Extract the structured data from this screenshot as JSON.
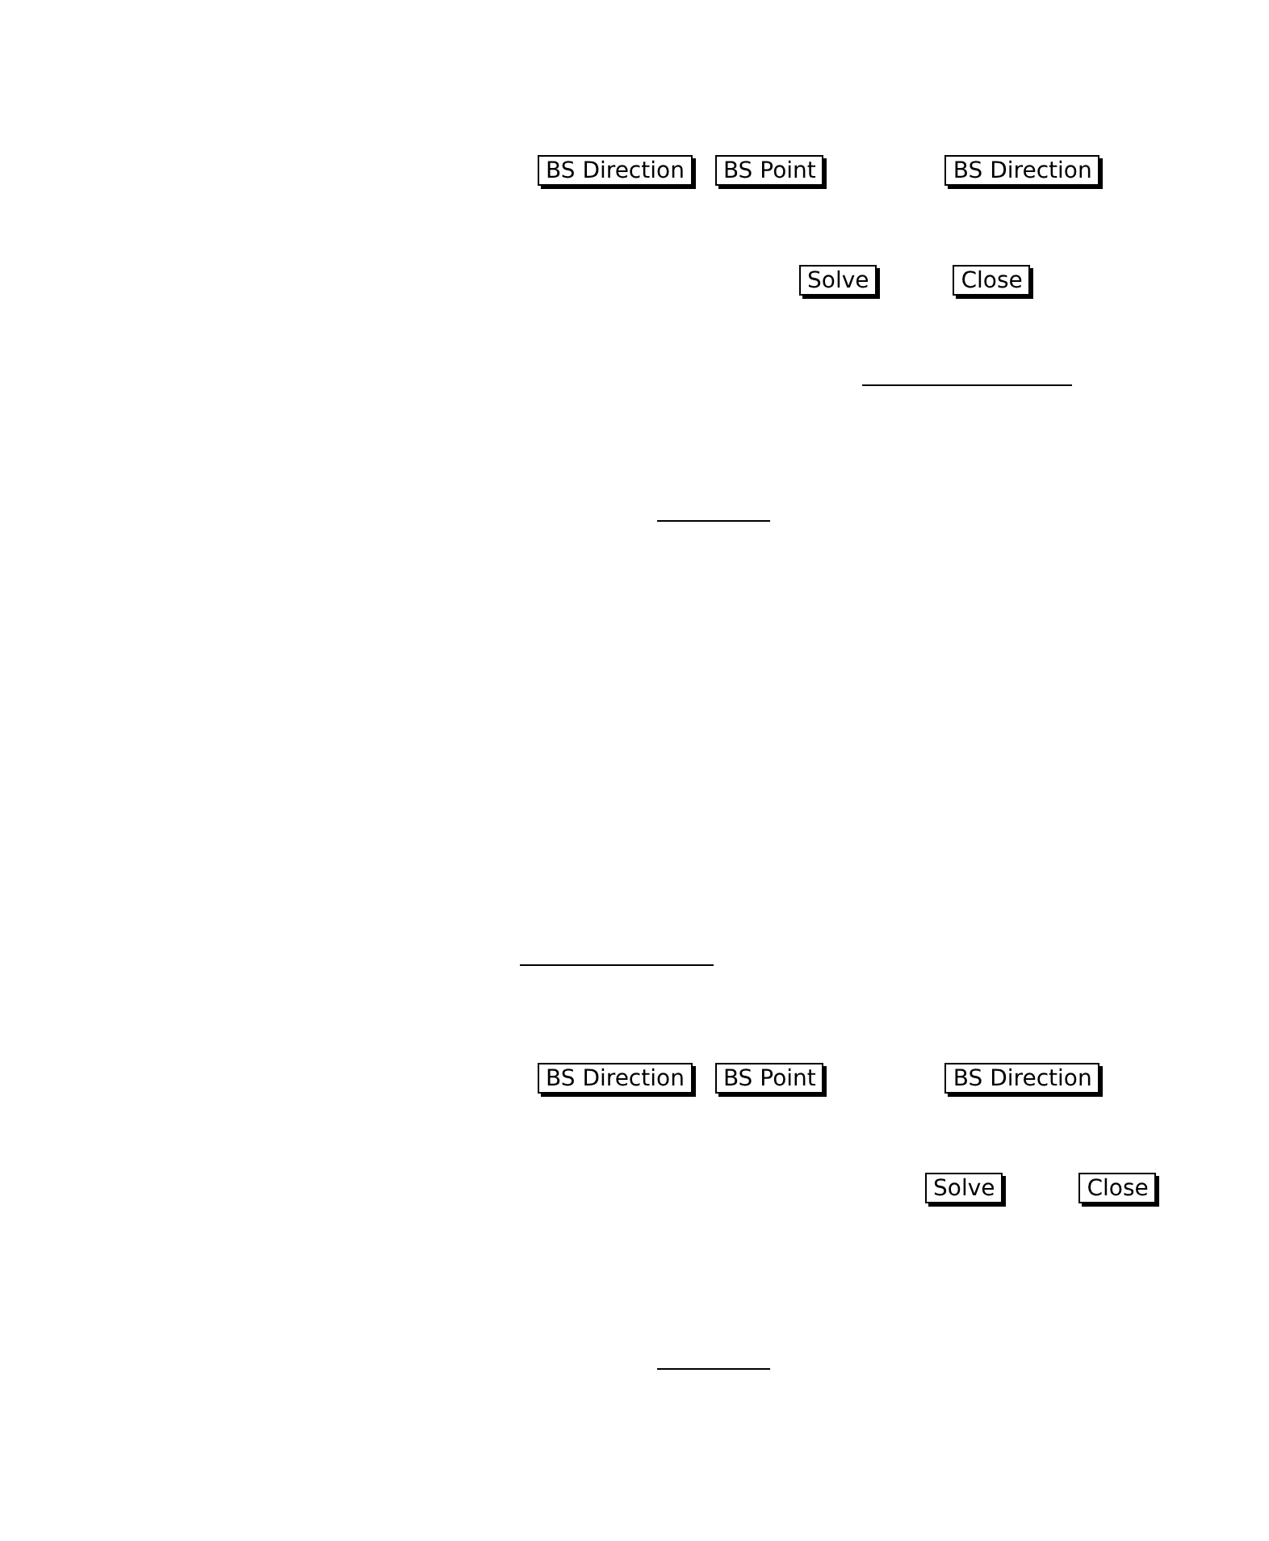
{
  "panels": [
    {
      "direction_buttons": [
        "BS Direction",
        "BS Point",
        "BS Direction"
      ],
      "action_buttons": [
        "Solve",
        "Close"
      ]
    },
    {
      "direction_buttons": [
        "BS Direction",
        "BS Point",
        "BS Direction"
      ],
      "action_buttons": [
        "Solve",
        "Close"
      ]
    }
  ]
}
